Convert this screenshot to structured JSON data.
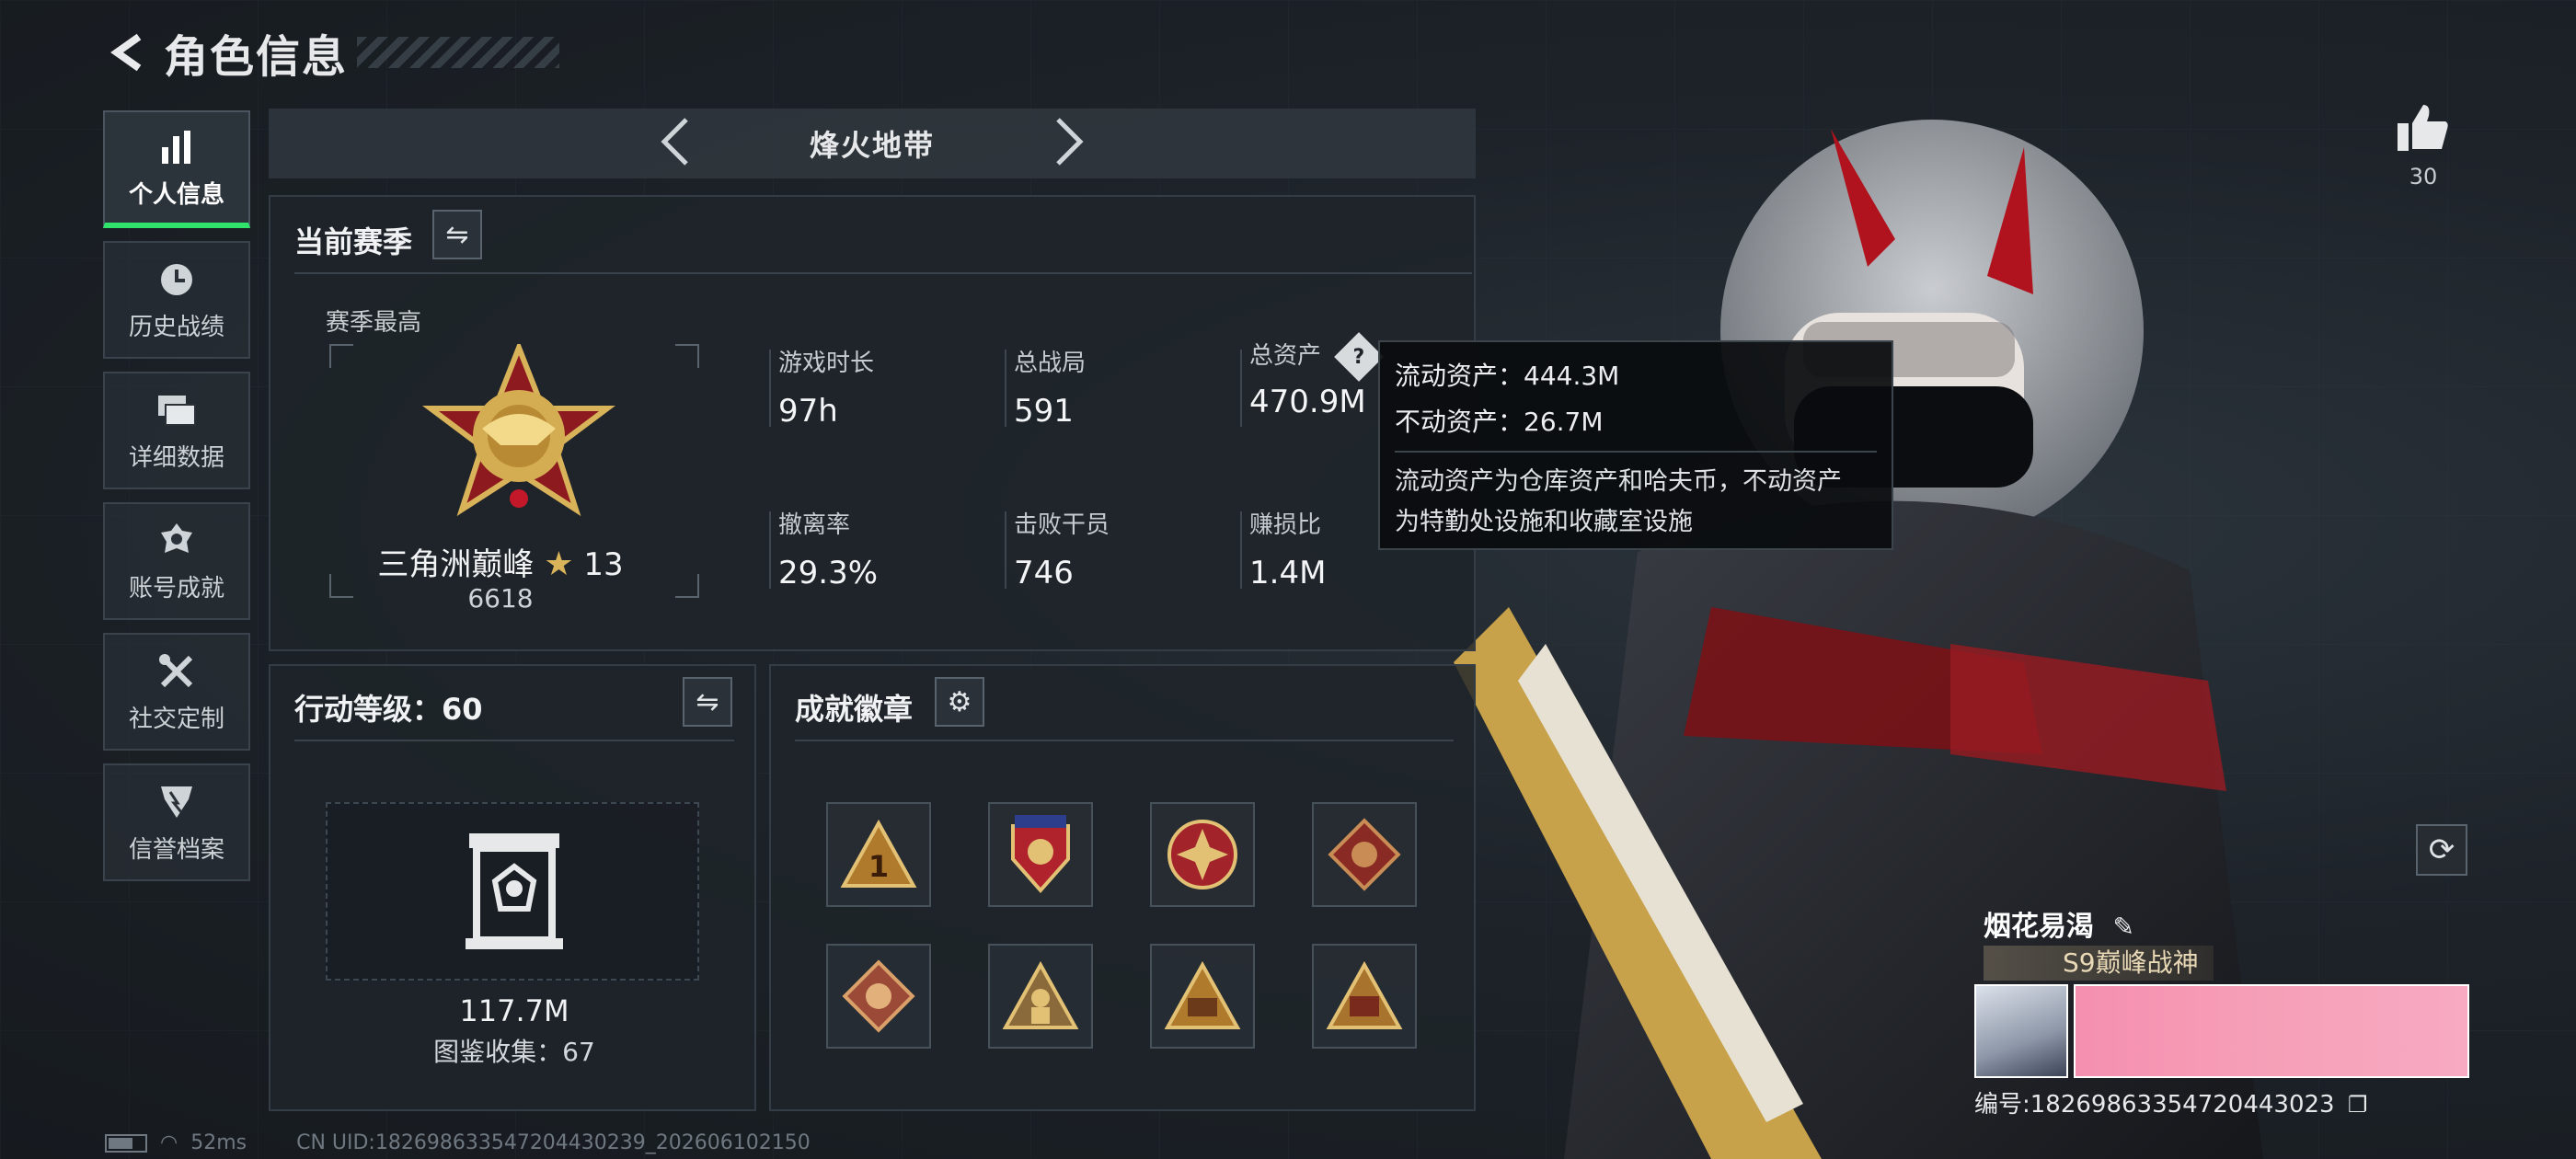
{
  "header": {
    "title": "角色信息"
  },
  "nav": [
    {
      "label": "个人信息",
      "icon": "bar-chart-icon",
      "active": true
    },
    {
      "label": "历史战绩",
      "icon": "clock-icon"
    },
    {
      "label": "详细数据",
      "icon": "folders-icon"
    },
    {
      "label": "账号成就",
      "icon": "medal-icon"
    },
    {
      "label": "社交定制",
      "icon": "tools-icon"
    },
    {
      "label": "信誉档案",
      "icon": "shield-icon"
    }
  ],
  "mode": {
    "name": "烽火地带"
  },
  "season": {
    "title": "当前赛季",
    "best_label": "赛季最高",
    "rank_name": "三角洲巅峰",
    "rank_stars": "13",
    "rank_score": "6618",
    "stats": [
      {
        "label": "游戏时长",
        "value": "97h"
      },
      {
        "label": "总战局",
        "value": "591"
      },
      {
        "label": "总资产",
        "value": "470.9M"
      },
      {
        "label": "撤离率",
        "value": "29.3%"
      },
      {
        "label": "击败干员",
        "value": "746"
      },
      {
        "label": "赚损比",
        "value": "1.4M"
      }
    ]
  },
  "tooltip": {
    "line1": "流动资产：444.3M",
    "line2": "不动资产：26.7M",
    "desc1": "流动资产为仓库资产和哈夫币，不动资产",
    "desc2": "为特勤处设施和收藏室设施"
  },
  "action": {
    "title": "行动等级：60",
    "value": "117.7M",
    "collection": "图鉴收集：67"
  },
  "badges": {
    "title": "成就徽章",
    "items": [
      "badge-1-icon",
      "badge-stars-icon",
      "badge-cross-icon",
      "badge-dragon-icon",
      "badge-dragon-2-icon",
      "badge-soldier-icon",
      "badge-s9-icon",
      "badge-s8-icon"
    ]
  },
  "player": {
    "likes": "30",
    "name": "烟花易渴",
    "title": "S9巅峰战神",
    "id_text": "编号:18269863354720443023"
  },
  "footer": {
    "ping": "52ms",
    "uid": "CN UID:182698633547204430239_202606102150"
  },
  "colors": {
    "accent": "#2fe36b",
    "panel": "#1e242a",
    "tooltip_bg": "#0a0c0e"
  }
}
